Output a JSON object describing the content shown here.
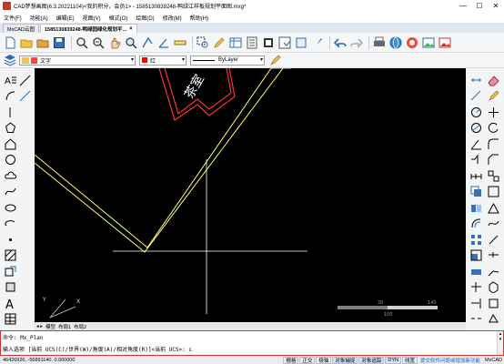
{
  "window": {
    "title": "CAD梦想画图(6.3.20221104)<我的积分，会员1> - 1585130839248-鸭绿江样板规划平面图.mxg*",
    "minimize": "—",
    "maximize": "☐",
    "close": "✕"
  },
  "menu": [
    "文件(F)",
    "功能(A)",
    "编辑(E)",
    "视图(V)",
    "格式(O)",
    "绘图(D)",
    "修改(M)",
    "帮助(H)"
  ],
  "tabs": [
    {
      "label": "MxCAD云图",
      "active": false
    },
    {
      "label": "1585130839248-鸭绿园绿化规划平...",
      "active": true
    }
  ],
  "toolbar2": {
    "layer": "文字",
    "color": "红",
    "linetype": "ByLayer"
  },
  "drawing": {
    "text": "茶室"
  },
  "scale_bar": {
    "labels": [
      "20",
      "140",
      "100"
    ]
  },
  "layout_tabs": [
    "模型",
    "布局1",
    "布局2"
  ],
  "command": {
    "line1": "命令: Mx_Plan",
    "line2": "输入选项 [当前 UCS(C)/世界(W)/角度(A)/相对角度(R)]<当前 UCS>: c"
  },
  "status": {
    "coords": "46426926,  -56891140,  0.000000",
    "buttons": [
      {
        "label": "栅格",
        "on": false
      },
      {
        "label": "正交",
        "on": false
      },
      {
        "label": "极轴",
        "on": false
      },
      {
        "label": "对象捕捉",
        "on": true
      },
      {
        "label": "对象追踪",
        "on": true
      },
      {
        "label": "DYN",
        "on": true
      },
      {
        "label": "线宽",
        "on": false
      }
    ],
    "link": "提交软件问题或增加新功能",
    "brand": "MxCAD"
  }
}
